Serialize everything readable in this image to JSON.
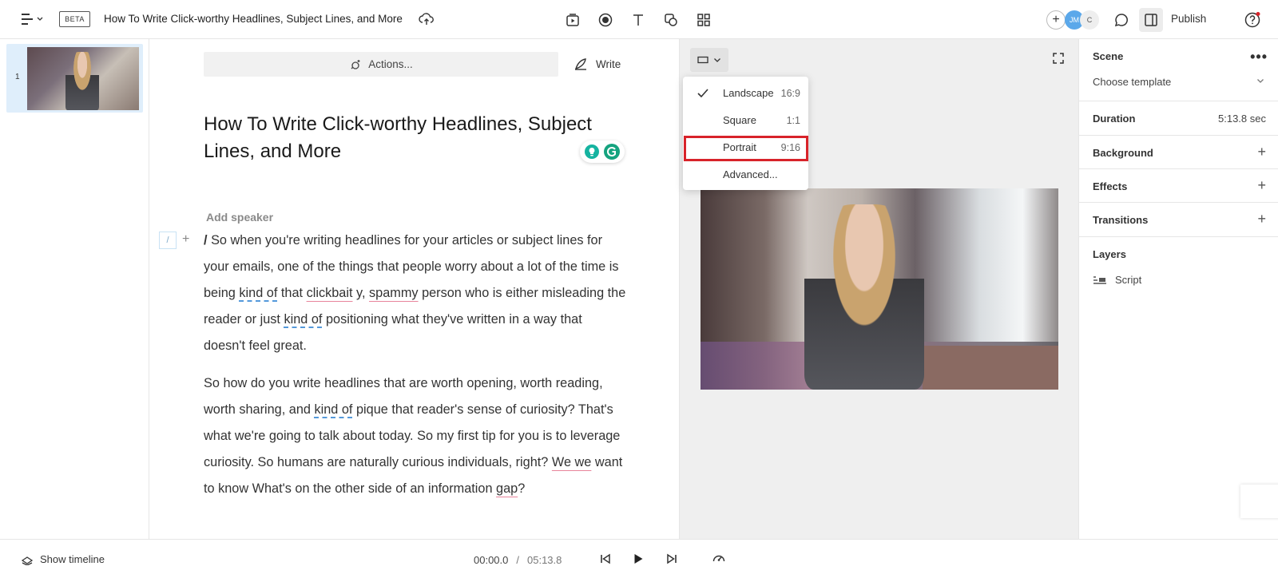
{
  "header": {
    "beta_label": "BETA",
    "document_title": "How To Write Click-worthy Headlines, Subject Lines, and More",
    "avatars": [
      "JM",
      "C"
    ],
    "publish_label": "Publish"
  },
  "scenes": [
    {
      "number": "1"
    }
  ],
  "editor": {
    "actions_label": "Actions...",
    "write_label": "Write",
    "title": "How To Write Click-worthy Headlines, Subject Lines, and More",
    "add_speaker": "Add speaker",
    "paragraph1": {
      "prefix": "/ ",
      "t1": " So when you're writing headlines for your articles or subject lines for your emails, one of the things that people worry about a lot of the time is being ",
      "u1": "kind of",
      "t2": " that ",
      "u2": "clickbait",
      "t3": " y, ",
      "u3": "spammy",
      "t4": " person who is either misleading the reader or just ",
      "u4": "kind of",
      "t5": " positioning what they've written in a way that doesn't feel great."
    },
    "paragraph2": {
      "t1": "So how do you write headlines that are worth opening, worth reading, worth sharing, and ",
      "u1": "kind of",
      "t2": " pique that reader's sense of curiosity? That's what we're going to talk about today. So my first tip for you is to leverage curiosity. So humans are naturally curious individuals, right? ",
      "u2": "We we",
      "t3": " want to know What's on the other side of an information ",
      "u3": "gap",
      "t4": "?"
    }
  },
  "aspect_menu": {
    "items": [
      {
        "label": "Landscape",
        "ratio": "16:9",
        "checked": true
      },
      {
        "label": "Square",
        "ratio": "1:1",
        "checked": false
      },
      {
        "label": "Portrait",
        "ratio": "9:16",
        "checked": false,
        "highlighted": true
      },
      {
        "label": "Advanced...",
        "ratio": "",
        "checked": false
      }
    ]
  },
  "right_panel": {
    "scene_label": "Scene",
    "template_placeholder": "Choose template",
    "duration_label": "Duration",
    "duration_value": "5:13.8 sec",
    "background_label": "Background",
    "effects_label": "Effects",
    "transitions_label": "Transitions",
    "layers_label": "Layers",
    "layers": [
      "Script"
    ]
  },
  "playback": {
    "show_timeline_label": "Show timeline",
    "current_time": "00:00.0",
    "separator": "/",
    "total_time": "05:13.8"
  },
  "colors": {
    "highlight_border": "#d8232a",
    "selected_scene_bg": "#dfeefb",
    "preview_bg": "#efefef"
  }
}
